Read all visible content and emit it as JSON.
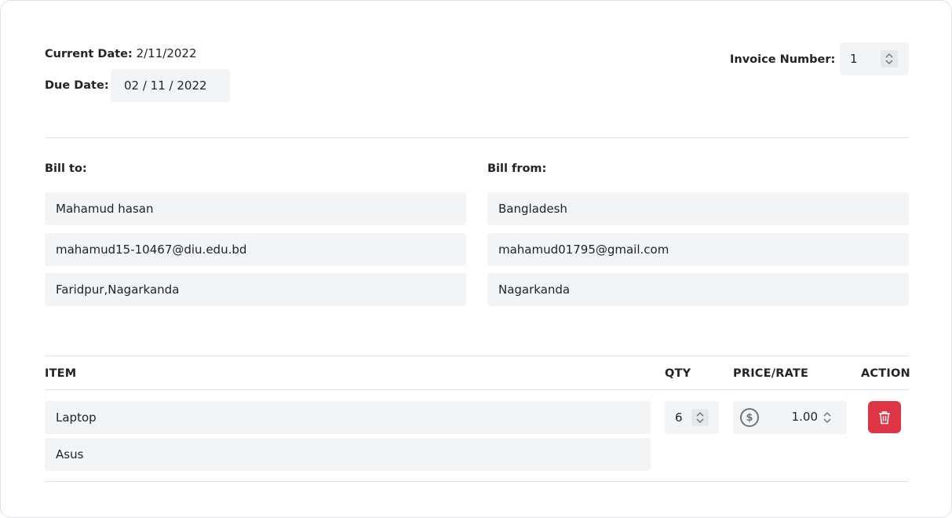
{
  "header": {
    "current_date_label": "Current Date:",
    "current_date_value": "2/11/2022",
    "due_date_label": "Due Date:",
    "due_date_value": "02 / 11 / 2022",
    "invoice_number_label": "Invoice Number:",
    "invoice_number_value": "1"
  },
  "bill_to": {
    "label": "Bill to:",
    "name": "Mahamud hasan",
    "email": "mahamud15-10467@diu.edu.bd",
    "address": "Faridpur,Nagarkanda"
  },
  "bill_from": {
    "label": "Bill from:",
    "name": "Bangladesh",
    "email": "mahamud01795@gmail.com",
    "address": "Nagarkanda"
  },
  "items_table": {
    "headers": {
      "item": "ITEM",
      "qty": "QTY",
      "price": "PRICE/RATE",
      "action": "ACTION"
    },
    "rows": [
      {
        "name": "Laptop",
        "description": "Asus",
        "qty": "6",
        "price": "1.00"
      }
    ]
  },
  "icons": {
    "spinner": "up-down-chevron-icon",
    "currency": "dollar-circle-icon",
    "delete": "trash-icon"
  },
  "colors": {
    "field_bg": "#f3f4f6",
    "delete_button": "#dc3545",
    "divider": "#dee2e6"
  }
}
